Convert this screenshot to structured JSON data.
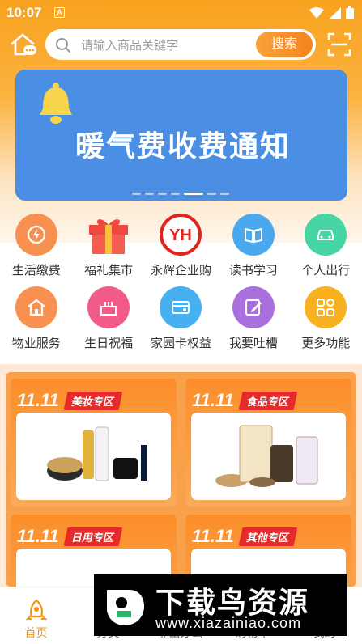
{
  "status_bar": {
    "time": "10:07",
    "notification_letter": "A"
  },
  "search": {
    "placeholder": "请输入商品关键字",
    "button_label": "搜索"
  },
  "banner": {
    "title": "暖气费收费通知",
    "slide_count": 7,
    "active_slide": 5
  },
  "services": {
    "row1": [
      {
        "label": "生活缴费",
        "icon": "bill-icon",
        "color": "#f57f4a"
      },
      {
        "label": "福礼集市",
        "icon": "gift-icon",
        "color": "#f0473f"
      },
      {
        "label": "永辉企业购",
        "icon": "yh-logo-icon",
        "color": "#e0251c"
      },
      {
        "label": "读书学习",
        "icon": "book-icon",
        "color": "#3c9ee8"
      },
      {
        "label": "个人出行",
        "icon": "car-icon",
        "color": "#3dcf9a"
      }
    ],
    "row2": [
      {
        "label": "物业服务",
        "icon": "house-icon",
        "color": "#f5834b"
      },
      {
        "label": "生日祝福",
        "icon": "cake-icon",
        "color": "#f0497a"
      },
      {
        "label": "家园卡权益",
        "icon": "card-icon",
        "color": "#3ea9ee"
      },
      {
        "label": "我要吐槽",
        "icon": "edit-icon",
        "color": "#a368d8"
      },
      {
        "label": "更多功能",
        "icon": "grid-icon",
        "color": "#f9a51c"
      }
    ]
  },
  "promo": {
    "cards": [
      {
        "date": "11.11",
        "tag": "美妆专区"
      },
      {
        "date": "11.11",
        "tag": "食品专区"
      },
      {
        "date": "11.11",
        "tag": "日用专区"
      },
      {
        "date": "11.11",
        "tag": "其他专区"
      }
    ]
  },
  "tabbar": {
    "home": "首页",
    "tab2": "分类",
    "tab3": "非出办公",
    "tab4": "购物车",
    "tab5": "我的"
  },
  "watermark": {
    "title": "下载鸟资源",
    "url": "www.xiazainiao.com"
  }
}
